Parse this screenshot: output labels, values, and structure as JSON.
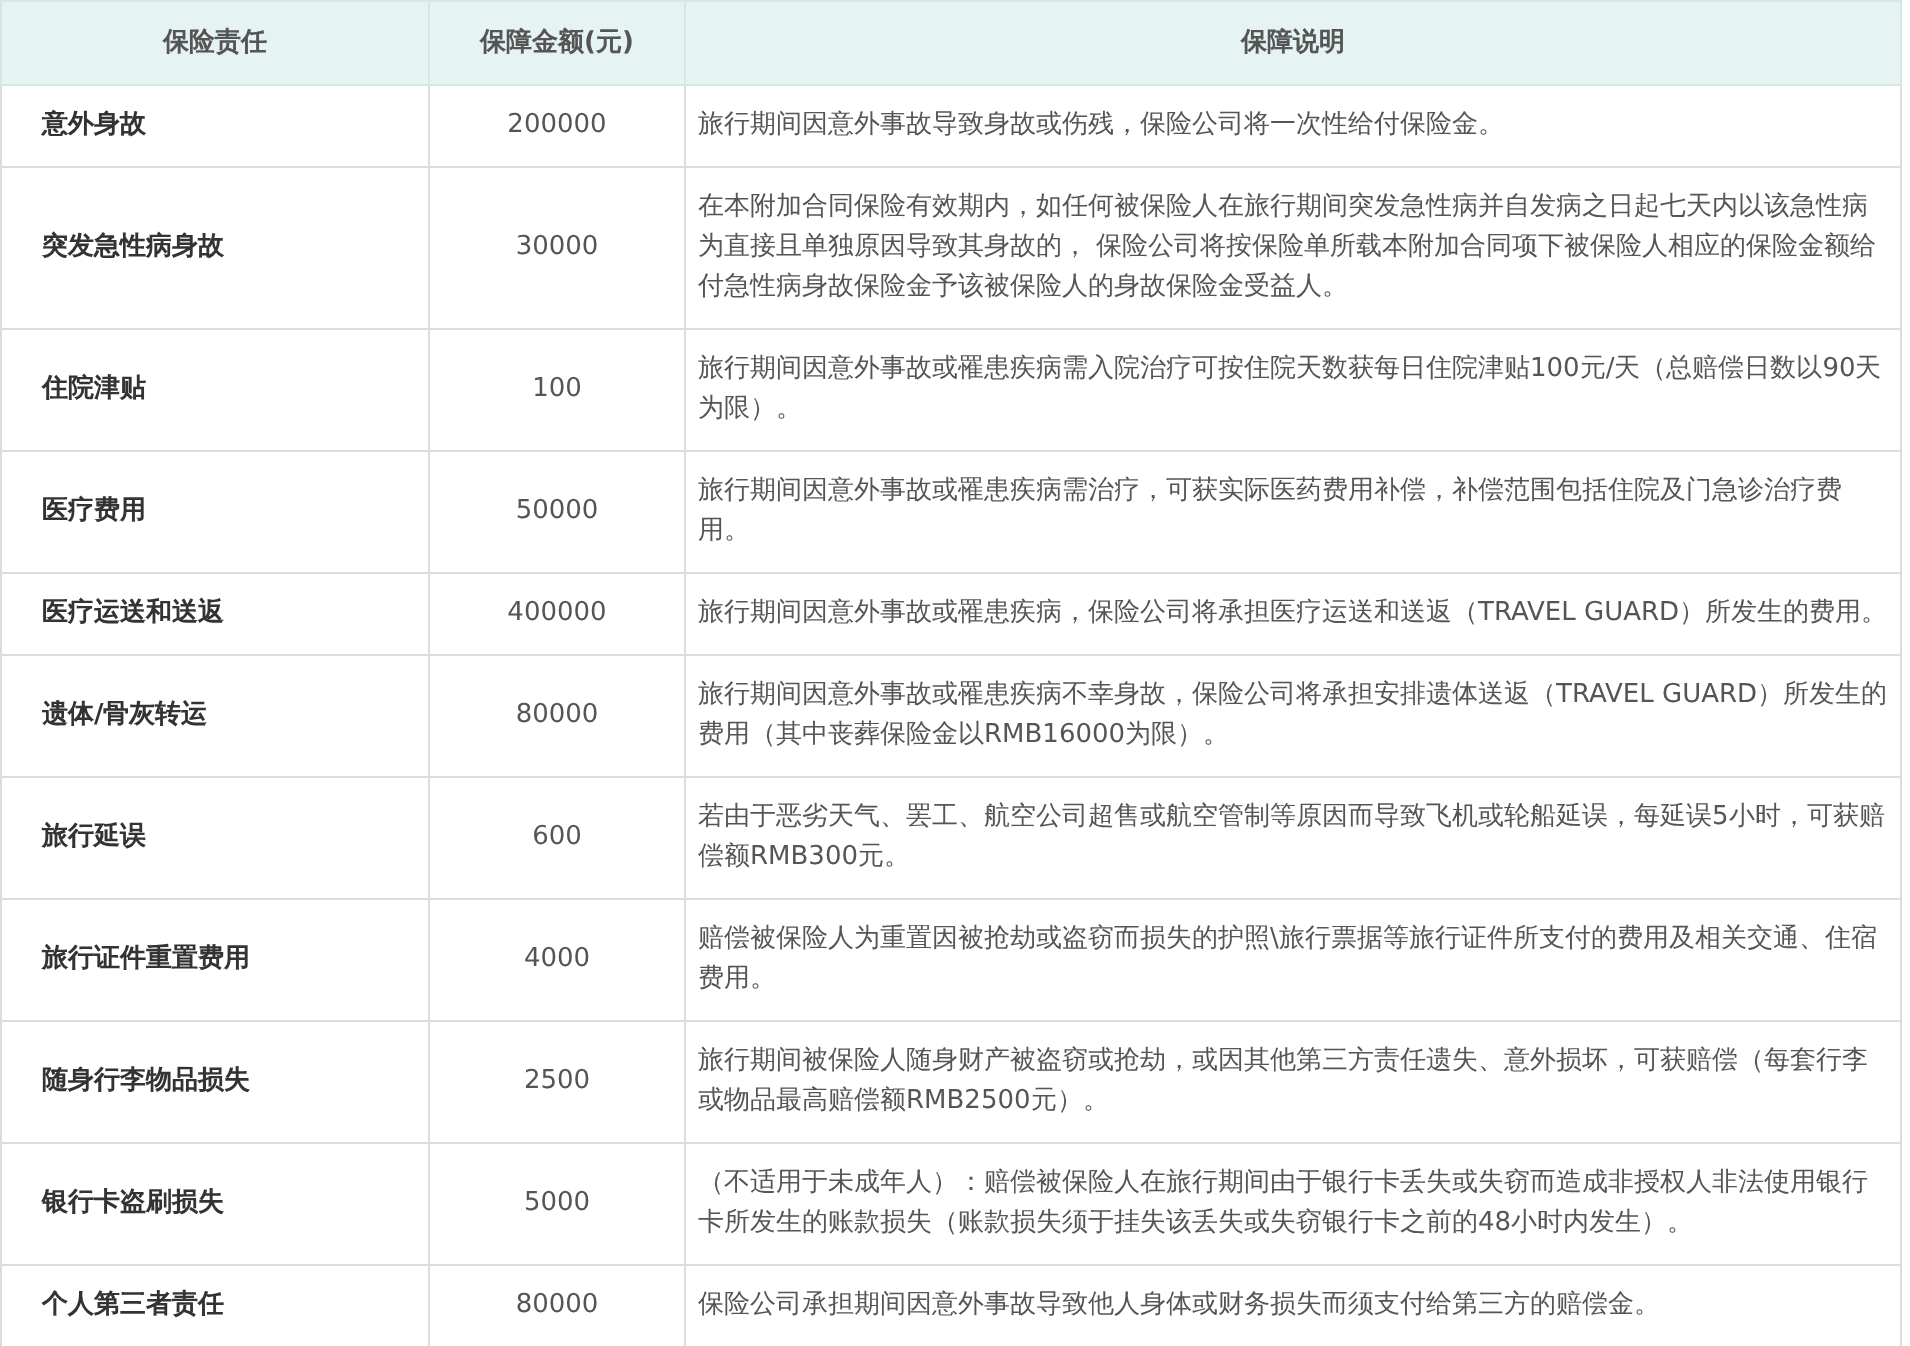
{
  "table": {
    "columns": [
      "保险责任",
      "保障金额(元)",
      "保障说明"
    ],
    "rows": [
      {
        "name": "意外身故",
        "amount": "200000",
        "description": "旅行期间因意外事故导致身故或伤残，保险公司将一次性给付保险金。"
      },
      {
        "name": "突发急性病身故",
        "amount": "30000",
        "description": "在本附加合同保险有效期内，如任何被保险人在旅行期间突发急性病并自发病之日起七天内以该急性病为直接且单独原因导致其身故的， 保险公司将按保险单所载本附加合同项下被保险人相应的保险金额给付急性病身故保险金予该被保险人的身故保险金受益人。"
      },
      {
        "name": "住院津贴",
        "amount": "100",
        "description": "旅行期间因意外事故或罹患疾病需入院治疗可按住院天数获每日住院津贴100元/天（总赔偿日数以90天为限）。"
      },
      {
        "name": "医疗费用",
        "amount": "50000",
        "description": "旅行期间因意外事故或罹患疾病需治疗，可获实际医药费用补偿，补偿范围包括住院及门急诊治疗费用。"
      },
      {
        "name": "医疗运送和送返",
        "amount": "400000",
        "description": "旅行期间因意外事故或罹患疾病，保险公司将承担医疗运送和送返（TRAVEL GUARD）所发生的费用。"
      },
      {
        "name": "遗体/骨灰转运",
        "amount": "80000",
        "description": "旅行期间因意外事故或罹患疾病不幸身故，保险公司将承担安排遗体送返（TRAVEL GUARD）所发生的费用（其中丧葬保险金以RMB16000为限）。"
      },
      {
        "name": "旅行延误",
        "amount": "600",
        "description": "若由于恶劣天气、罢工、航空公司超售或航空管制等原因而导致飞机或轮船延误，每延误5小时，可获赔偿额RMB300元。"
      },
      {
        "name": "旅行证件重置费用",
        "amount": "4000",
        "description": "赔偿被保险人为重置因被抢劫或盗窃而损失的护照\\旅行票据等旅行证件所支付的费用及相关交通、住宿费用。"
      },
      {
        "name": "随身行李物品损失",
        "amount": "2500",
        "description": "旅行期间被保险人随身财产被盗窃或抢劫，或因其他第三方责任遗失、意外损坏，可获赔偿（每套行李或物品最高赔偿额RMB2500元）。"
      },
      {
        "name": "银行卡盗刷损失",
        "amount": "5000",
        "description": "（不适用于未成年人）：赔偿被保险人在旅行期间由于银行卡丢失或失窃而造成非授权人非法使用银行卡所发生的账款损失（账款损失须于挂失该丢失或失窃银行卡之前的48小时内发生）。"
      },
      {
        "name": "个人第三者责任",
        "amount": "80000",
        "description": "保险公司承担期间因意外事故导致他人身体或财务损失而须支付给第三方的赔偿金。"
      }
    ]
  }
}
